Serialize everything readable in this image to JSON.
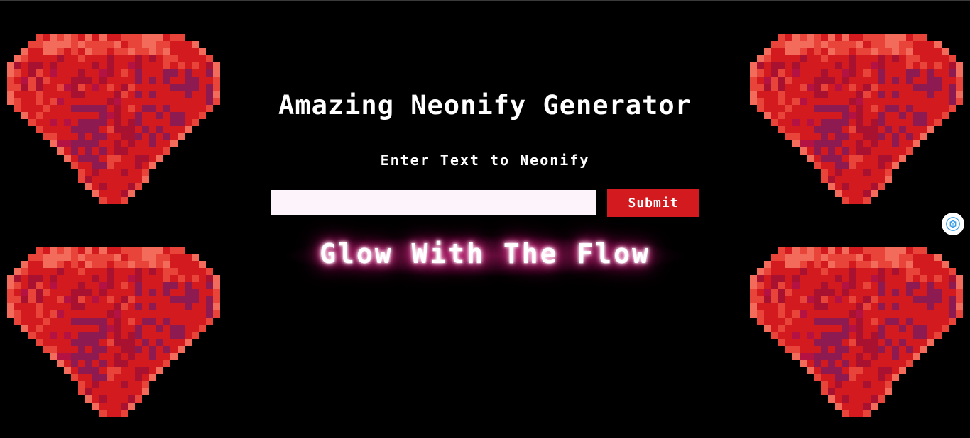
{
  "header": {
    "title": "Amazing Neonify Generator",
    "subtitle": "Enter Text to Neonify"
  },
  "form": {
    "input_value": "",
    "submit_label": "Submit"
  },
  "preview": {
    "neon_text": "Glow With The Flow",
    "glow_color": "#ff2d95"
  },
  "decorations": {
    "gem_icon": "ruby-gem-icon",
    "gem_colors": [
      "#d31a1f",
      "#e8443a",
      "#f26b5b",
      "#a81230",
      "#8e1a52",
      "#b31243"
    ]
  },
  "floating": {
    "assistant_icon": "ai-assistant-icon"
  }
}
